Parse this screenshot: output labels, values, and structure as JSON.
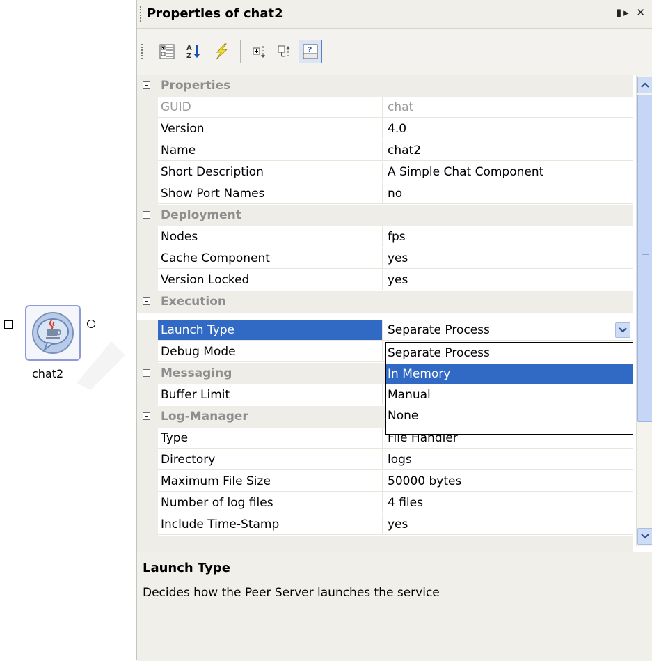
{
  "canvas": {
    "component_label": "chat2",
    "component_icon": "java-chat-icon"
  },
  "panel": {
    "title": "Properties of chat2",
    "title_buttons": [
      "pin-icon",
      "close-icon"
    ],
    "toolbar": [
      {
        "name": "categorized-view-button",
        "icon": "categorized-icon",
        "active": false
      },
      {
        "name": "alphabetical-sort-button",
        "icon": "az-sort-icon",
        "active": false
      },
      {
        "name": "events-button",
        "icon": "lightning-icon",
        "active": false
      },
      {
        "name": "expand-all-button",
        "icon": "expand-icon",
        "active": false
      },
      {
        "name": "collapse-all-button",
        "icon": "collapse-icon",
        "active": false
      },
      {
        "name": "help-toggle-button",
        "icon": "help-panel-icon",
        "active": true
      }
    ]
  },
  "grid": {
    "categories": {
      "properties": "Properties",
      "deployment": "Deployment",
      "execution": "Execution",
      "messaging": "Messaging",
      "log_manager": "Log-Manager"
    },
    "rows": {
      "guid": {
        "name": "GUID",
        "value": "chat"
      },
      "version": {
        "name": "Version",
        "value": "4.0"
      },
      "name": {
        "name": "Name",
        "value": "chat2"
      },
      "short_description": {
        "name": "Short Description",
        "value": "A Simple Chat Component"
      },
      "show_port_names": {
        "name": "Show Port Names",
        "value": "no"
      },
      "nodes": {
        "name": "Nodes",
        "value": "fps"
      },
      "cache_component": {
        "name": "Cache Component",
        "value": "yes"
      },
      "version_locked": {
        "name": "Version Locked",
        "value": "yes"
      },
      "launch_type": {
        "name": "Launch Type",
        "value": "Separate Process"
      },
      "debug_mode": {
        "name": "Debug Mode",
        "value": ""
      },
      "buffer_limit": {
        "name": "Buffer Limit",
        "value": ""
      },
      "type": {
        "name": "Type",
        "value": "File Handler"
      },
      "directory": {
        "name": "Directory",
        "value": "logs"
      },
      "max_file_size": {
        "name": "Maximum File Size",
        "value": "50000 bytes"
      },
      "num_log_files": {
        "name": "Number of log files",
        "value": "4 files"
      },
      "include_timestamp": {
        "name": "Include Time-Stamp",
        "value": "yes"
      }
    },
    "dropdown_options": [
      "Separate Process",
      "In Memory",
      "Manual",
      "None"
    ],
    "dropdown_highlighted": "In Memory"
  },
  "help": {
    "title": "Launch Type",
    "description": "Decides how the Peer Server launches the service"
  },
  "colors": {
    "selection": "#316ac5",
    "category_bg": "#eeede7",
    "panel_bg": "#f0efe9"
  }
}
